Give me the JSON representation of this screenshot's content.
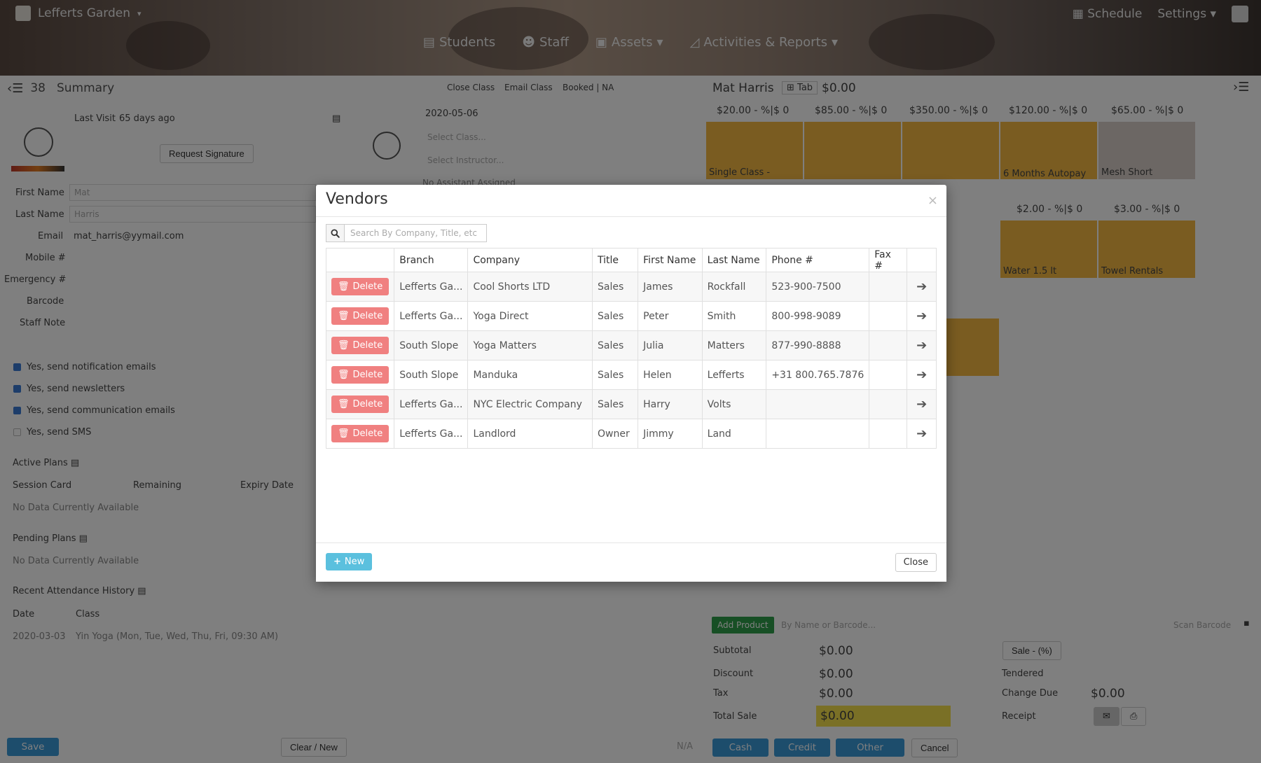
{
  "header": {
    "brand": "Lefferts Garden",
    "schedule": "Schedule",
    "settings": "Settings",
    "nav": [
      {
        "label": "Students"
      },
      {
        "label": "Staff"
      },
      {
        "label": "Assets"
      },
      {
        "label": "Activities & Reports"
      }
    ]
  },
  "left": {
    "count": "38",
    "title": "Summary",
    "last_visit_label": "Last Visit",
    "last_visit_value": "65 days ago",
    "request_signature": "Request Signature",
    "first_name_label": "First Name",
    "first_name_value": "Mat",
    "last_name_label": "Last Name",
    "last_name_value": "Harris",
    "email_label": "Email",
    "email_value": "mat_harris@yymail.com",
    "mobile_label": "Mobile #",
    "emergency_label": "Emergency #",
    "barcode_label": "Barcode",
    "staff_note_label": "Staff Note",
    "checks": [
      {
        "label": "Yes, send notification emails"
      },
      {
        "label": "Yes, send newsletters"
      },
      {
        "label": "Yes, send communication emails"
      },
      {
        "label": "Yes, send SMS"
      }
    ],
    "active_plans": "Active Plans",
    "col_session": "Session Card",
    "col_remaining": "Remaining",
    "col_expiry": "Expiry Date",
    "no_data_1": "No Data Currently Available",
    "pending_plans": "Pending Plans",
    "no_data_2": "No Data Currently Available",
    "recent_history": "Recent Attendance History",
    "col_date": "Date",
    "col_class": "Class",
    "history_date": "2020-03-03",
    "history_class": "Yin Yoga (Mon, Tue, Wed, Thu, Fri, 09:30 AM)",
    "save": "Save",
    "clear_new": "Clear / New"
  },
  "middle": {
    "close_class": "Close Class",
    "email_class": "Email Class",
    "booked": "Booked | NA",
    "date": "2020-05-06",
    "select_class": "Select Class...",
    "select_instructor": "Select Instructor...",
    "no_assistant": "No Assistant Assigned",
    "na": "N/A"
  },
  "right": {
    "customer": "Mat Harris",
    "tab": "Tab",
    "balance": "$0.00",
    "prices": [
      "$20.00 - %|$ 0",
      "$85.00 - %|$ 0",
      "$350.00 - %|$ 0",
      "$120.00 - %|$ 0",
      "$65.00 - %|$ 0"
    ],
    "prices2": [
      "$2.00 - %|$ 0",
      "$3.00 - %|$ 0"
    ],
    "tile_labels": [
      "Single Class -",
      "6 Months Autopay",
      "Mesh Short"
    ],
    "tile_labels2": [
      "Water 1.5 lt",
      "Towel Rentals"
    ],
    "add_product": "Add Product",
    "product_placeholder": "By Name or Barcode...",
    "scan_barcode": "Scan Barcode",
    "subtotal_label": "Subtotal",
    "subtotal": "$0.00",
    "discount_label": "Discount",
    "discount": "$0.00",
    "tax_label": "Tax",
    "tax": "$0.00",
    "total_label": "Total Sale",
    "total": "$0.00",
    "sale_pct": "Sale - (%)",
    "tendered_label": "Tendered",
    "change_label": "Change Due",
    "change": "$0.00",
    "receipt_label": "Receipt",
    "cash": "Cash",
    "credit": "Credit",
    "other": "Other",
    "cancel": "Cancel"
  },
  "modal": {
    "title": "Vendors",
    "search_placeholder": "Search By Company, Title, etc ...",
    "columns": [
      "Branch",
      "Company",
      "Title",
      "First Name",
      "Last Name",
      "Phone #",
      "Fax #"
    ],
    "delete_label": "Delete",
    "rows": [
      {
        "branch": "Lefferts Ga...",
        "company": "Cool Shorts LTD",
        "title": "Sales",
        "first": "James",
        "last": "Rockfall",
        "phone": "523-900-7500",
        "fax": ""
      },
      {
        "branch": "Lefferts Ga...",
        "company": "Yoga Direct",
        "title": "Sales",
        "first": "Peter",
        "last": "Smith",
        "phone": "800-998-9089",
        "fax": ""
      },
      {
        "branch": "South Slope",
        "company": "Yoga Matters",
        "title": "Sales",
        "first": "Julia",
        "last": "Matters",
        "phone": "877-990-8888",
        "fax": ""
      },
      {
        "branch": "South Slope",
        "company": "Manduka",
        "title": "Sales",
        "first": "Helen",
        "last": "Lefferts",
        "phone": "+31 800.765.7876",
        "fax": ""
      },
      {
        "branch": "Lefferts Ga...",
        "company": "NYC Electric Company",
        "title": "Sales",
        "first": "Harry",
        "last": "Volts",
        "phone": "",
        "fax": ""
      },
      {
        "branch": "Lefferts Ga...",
        "company": "Landlord",
        "title": "Owner",
        "first": "Jimmy",
        "last": "Land",
        "phone": "",
        "fax": ""
      }
    ],
    "new_label": "New",
    "close_label": "Close"
  }
}
